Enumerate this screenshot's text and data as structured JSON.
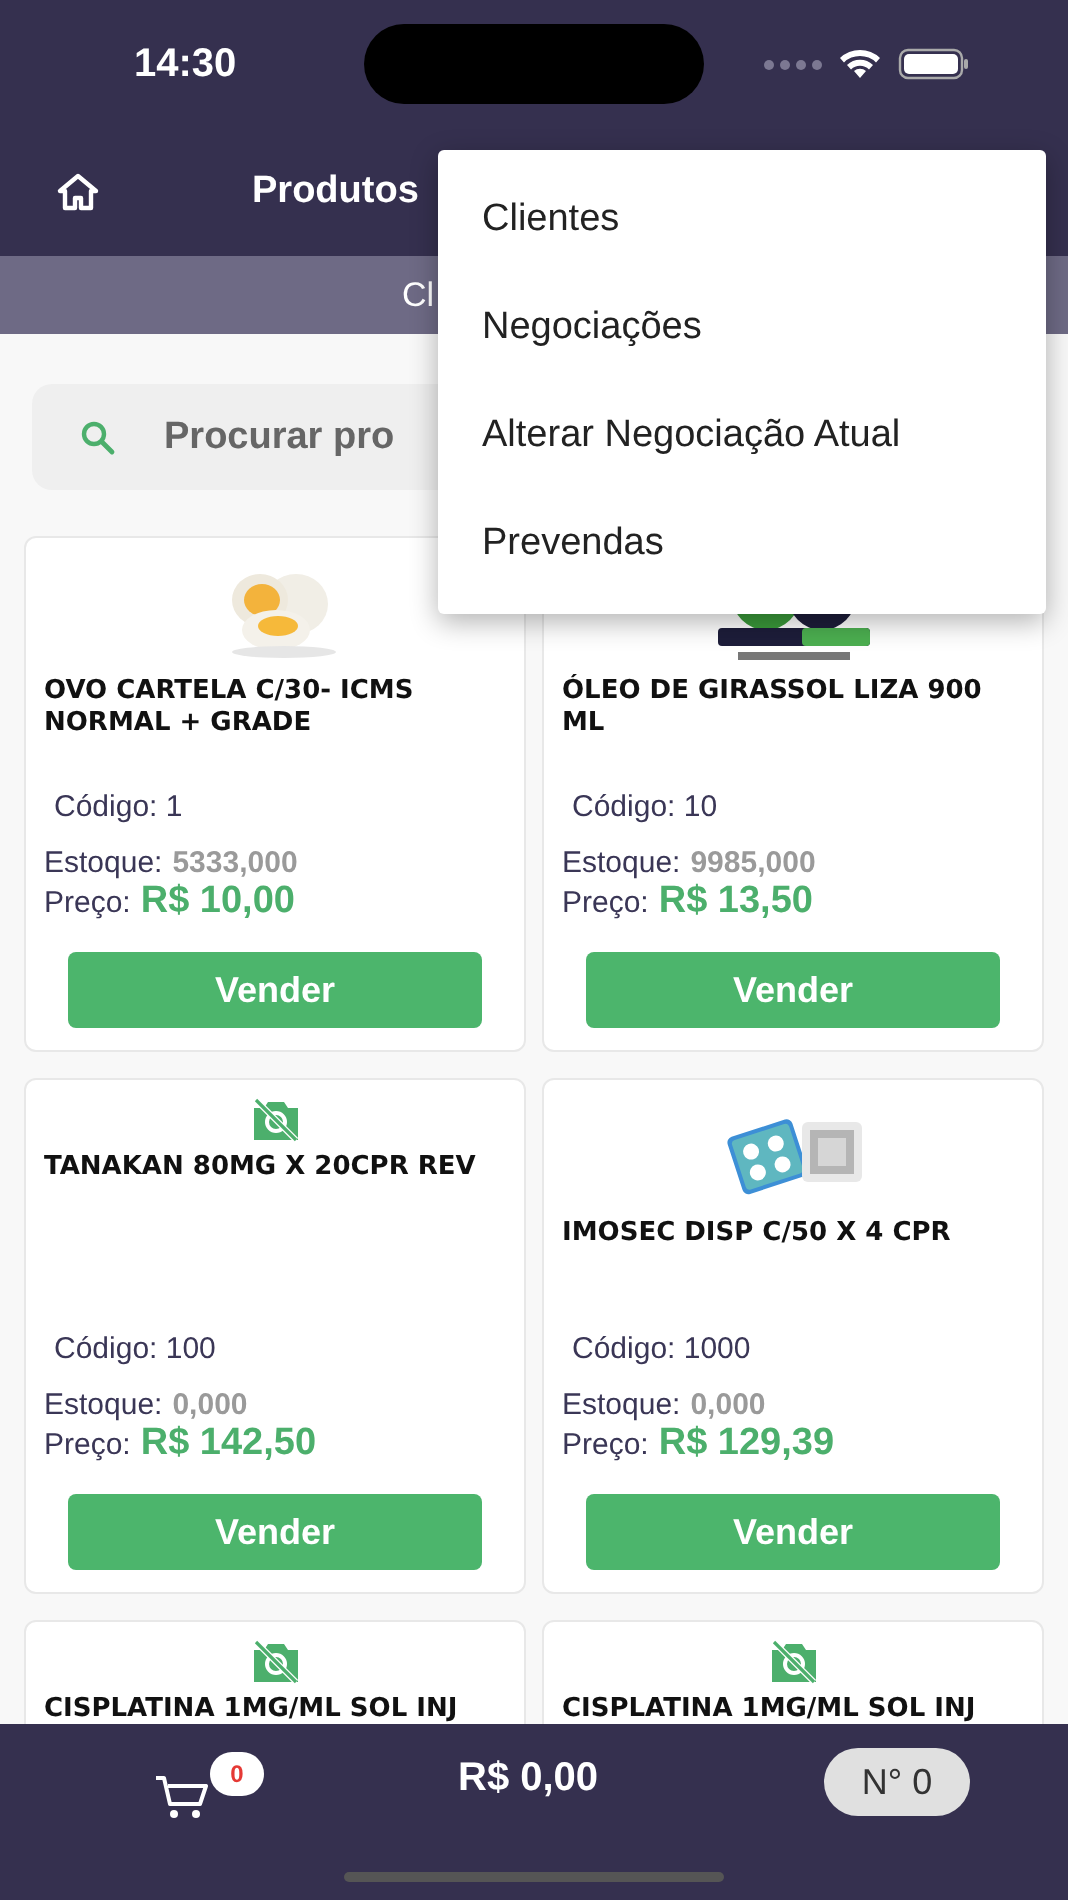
{
  "status_bar": {
    "time": "14:30"
  },
  "header": {
    "title": "Produtos",
    "subtitle": "Cl"
  },
  "search": {
    "placeholder": "Procurar pro"
  },
  "menu": {
    "items": [
      {
        "label": "Clientes"
      },
      {
        "label": "Negociações"
      },
      {
        "label": "Alterar Negociação Atual"
      },
      {
        "label": "Prevendas"
      }
    ]
  },
  "products": [
    {
      "name": "OVO CARTELA C/30- ICMS NORMAL + GRADE",
      "code": "Código: 1",
      "stock_label": "Estoque:",
      "stock": "5333,000",
      "price_label": "Preço:",
      "price": "R$ 10,00",
      "button": "Vender"
    },
    {
      "name": "ÓLEO DE GIRASSOL LIZA 900 ML",
      "code": "Código: 10",
      "stock_label": "Estoque:",
      "stock": "9985,000",
      "price_label": "Preço:",
      "price": "R$ 13,50",
      "button": "Vender"
    },
    {
      "image": {
        "kind": "no_image"
      },
      "name": "TANAKAN 80MG X 20CPR REV",
      "code": "Código: 100",
      "stock_label": "Estoque:",
      "stock": "0,000",
      "price_label": "Preço:",
      "price": "R$ 142,50",
      "button": "Vender"
    },
    {
      "name": "IMOSEC DISP C/50 X 4 CPR",
      "code": "Código: 1000",
      "stock_label": "Estoque:",
      "stock": "0,000",
      "price_label": "Preço:",
      "price": "R$ 129,39",
      "button": "Vender"
    },
    {
      "image": {
        "kind": "no_image"
      },
      "name": "CISPLATINA 1MG/ML SOL INJ"
    },
    {
      "image": {
        "kind": "no_image"
      },
      "name": "CISPLATINA 1MG/ML SOL INJ"
    }
  ],
  "footer": {
    "cart_count": "0",
    "total": "R$ 0,00",
    "order": "N° 0"
  }
}
